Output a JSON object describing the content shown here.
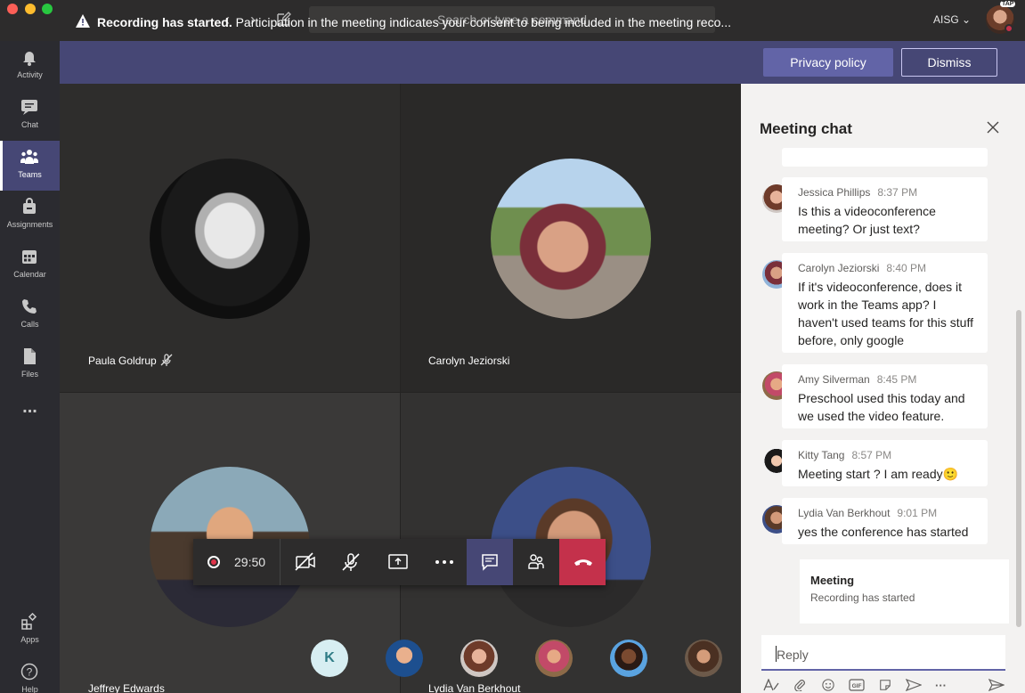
{
  "titlebar": {
    "search_placeholder": "Search or type a command",
    "org": "AISG",
    "org_chevron": "chevron-down-icon",
    "badge": "TAP"
  },
  "sidebar": {
    "items": [
      {
        "label": "Activity",
        "icon": "bell-icon"
      },
      {
        "label": "Chat",
        "icon": "chat-icon"
      },
      {
        "label": "Teams",
        "icon": "teams-icon",
        "active": true
      },
      {
        "label": "Assignments",
        "icon": "assignments-icon"
      },
      {
        "label": "Calendar",
        "icon": "calendar-icon"
      },
      {
        "label": "Calls",
        "icon": "phone-icon"
      },
      {
        "label": "Files",
        "icon": "file-icon"
      },
      {
        "label": "Apps",
        "icon": "apps-icon"
      },
      {
        "label": "Help",
        "icon": "help-icon"
      }
    ],
    "more": "..."
  },
  "banner": {
    "strong": "Recording has started.",
    "text": "Participation in the meeting indicates your consent to being included in the meeting reco...",
    "privacy_label": "Privacy policy",
    "dismiss_label": "Dismiss"
  },
  "tiles": [
    {
      "name": "Paula Goldrup",
      "muted": true
    },
    {
      "name": "Carolyn Jeziorski"
    },
    {
      "name": "Jeffrey Edwards"
    },
    {
      "name": "Lydia Van Berkhout"
    }
  ],
  "toolbar": {
    "timer": "29:50"
  },
  "participants": {
    "initial": "K"
  },
  "chat": {
    "title": "Meeting chat",
    "messages": [
      {
        "author": "Jessica Phillips",
        "time": "8:37 PM",
        "text": "Is this a videoconference meeting? Or just text?"
      },
      {
        "author": "Carolyn Jeziorski",
        "time": "8:40 PM",
        "text": "If it's videoconference, does it work in the Teams app? I haven't used teams for this stuff before, only google"
      },
      {
        "author": "Amy Silverman",
        "time": "8:45 PM",
        "text": "Preschool used this today and we used the video feature."
      },
      {
        "author": "Kitty Tang",
        "time": "8:57 PM",
        "text": "Meeting start ?  I am ready"
      },
      {
        "author": "Lydia Van Berkhout",
        "time": "9:01 PM",
        "text": "yes the conference has started"
      }
    ],
    "system": {
      "title": "Meeting",
      "subtitle": "Recording has started"
    },
    "reply_placeholder": "Reply",
    "emoji": "🙂"
  },
  "colors": {
    "accent": "#6264a7",
    "banner": "#464775",
    "hangup": "#c4314b"
  }
}
